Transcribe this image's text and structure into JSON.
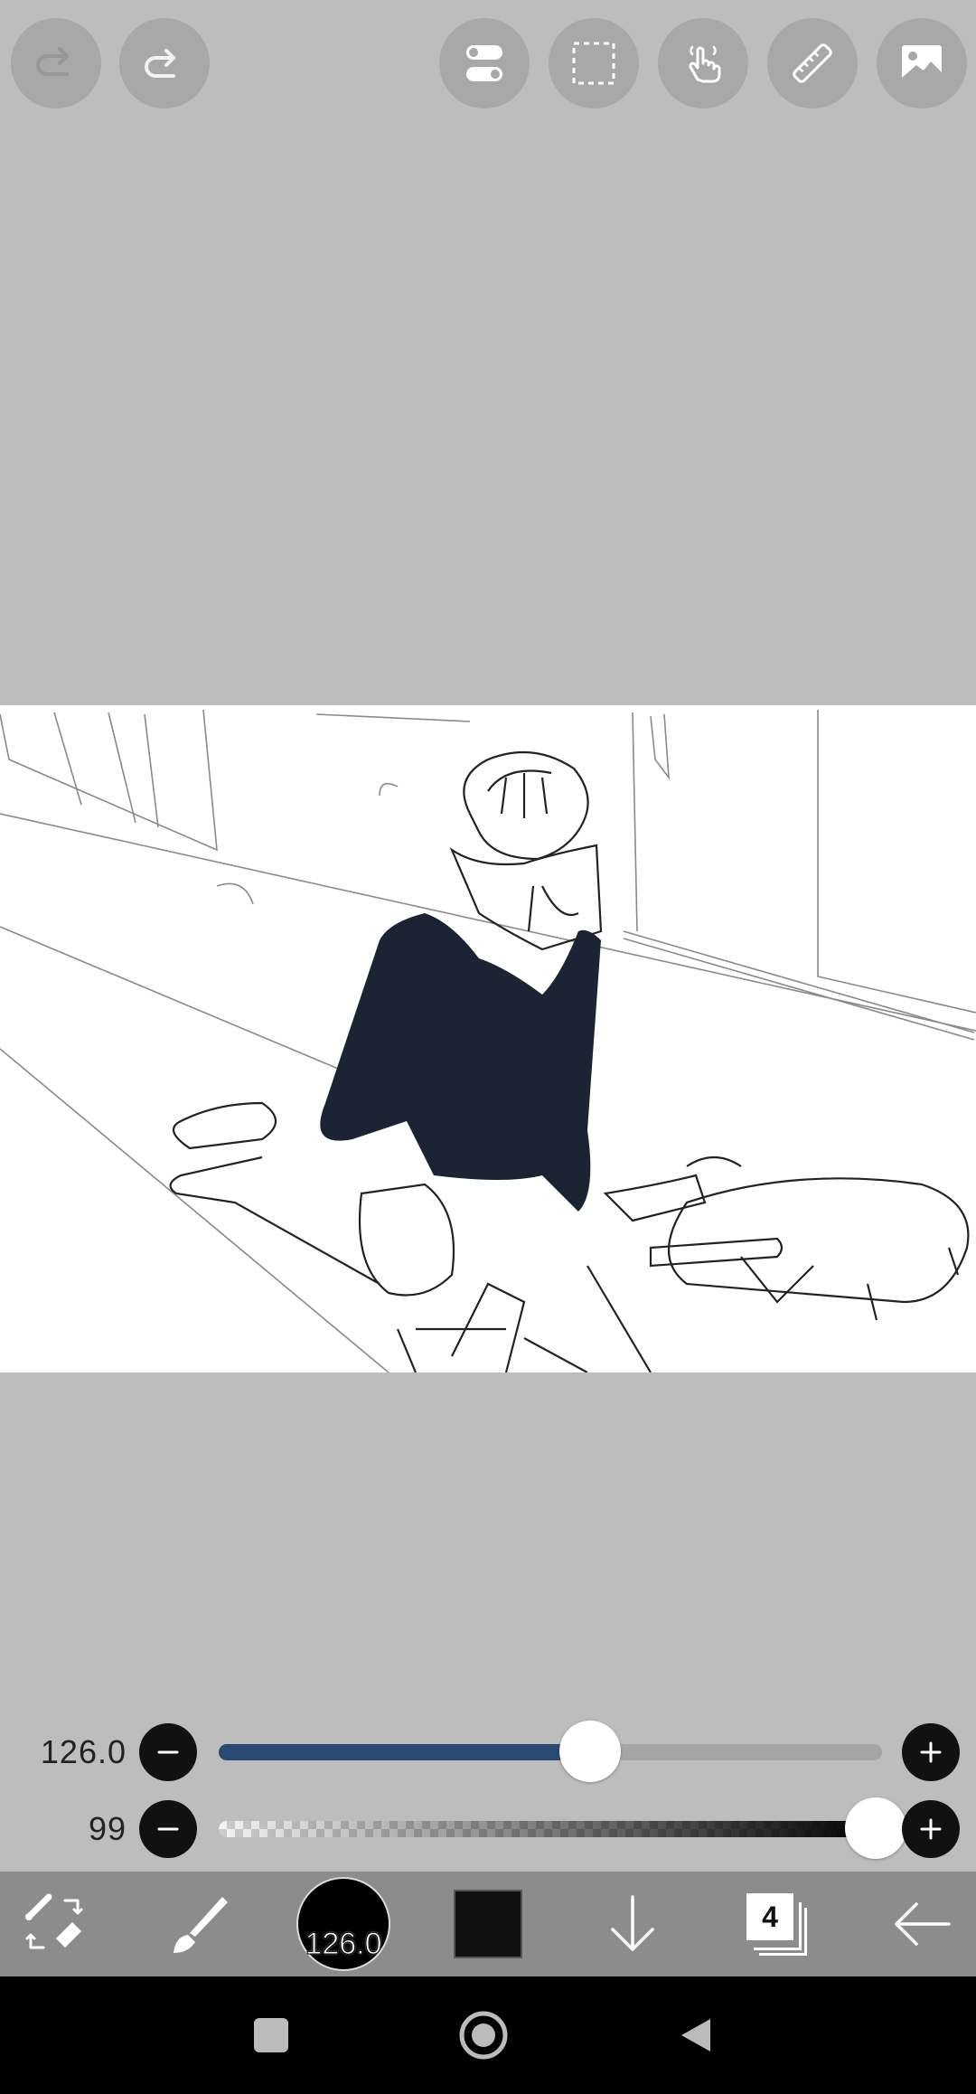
{
  "top_toolbar": {
    "buttons": [
      {
        "name": "undo",
        "icon": "undo-icon"
      },
      {
        "name": "redo",
        "icon": "redo-icon"
      },
      {
        "name": "toggle",
        "icon": "toggle-icon"
      },
      {
        "name": "selection",
        "icon": "selection-icon"
      },
      {
        "name": "hand",
        "icon": "hand-icon"
      },
      {
        "name": "ruler",
        "icon": "ruler-icon"
      },
      {
        "name": "image",
        "icon": "image-icon"
      }
    ]
  },
  "brush_size": {
    "value_label": "126.0",
    "level_fraction": 0.56
  },
  "brush_opacity": {
    "value_label": "99",
    "level_fraction": 0.99
  },
  "bottom_toolbar": {
    "brush_preview_label": "126.0",
    "layers_count": "4",
    "color": "#111111",
    "accent_color": "#2a4a74"
  },
  "canvas": {
    "background": "#ffffff",
    "fill_color": "#1c2433"
  }
}
